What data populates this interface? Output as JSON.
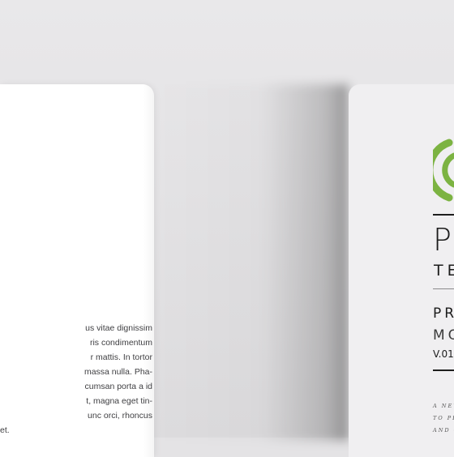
{
  "left_page": {
    "body_lines": [
      "us vitae dignissim",
      "ris condimentum",
      "r mattis. In tortor",
      "massa nulla. Pha-",
      "cumsan porta a id",
      "t, magna eget tin-",
      "unc orci, rhoncus",
      "et."
    ]
  },
  "right_page": {
    "logo_icon": "green-signal-arc-icon",
    "logo_color": "#7cb342",
    "brand": "P",
    "brand_sub": "TE",
    "title_line1": "PR",
    "title_line2": "MO",
    "version": "V.01",
    "tagline_lines": [
      "A NEW",
      "TO PR",
      "AND C"
    ]
  }
}
